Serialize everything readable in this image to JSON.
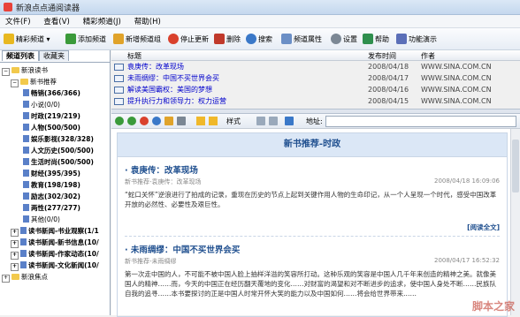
{
  "window": {
    "title": "新浪点点通阅读器"
  },
  "menu": [
    "文件(F)",
    "查看(V)",
    "精彩频道(J)",
    "帮助(H)"
  ],
  "toolbar": [
    {
      "label": "精彩频道",
      "icon": "star-icon",
      "color": "#e8b820"
    },
    {
      "label": "添加频道",
      "icon": "add-icon",
      "color": "#3a9a3a"
    },
    {
      "label": "新增频道组",
      "icon": "folder-add-icon",
      "color": "#e0a32a"
    },
    {
      "label": "停止更新",
      "icon": "stop-icon",
      "color": "#d9412d"
    },
    {
      "label": "删除",
      "icon": "delete-icon",
      "color": "#c0392b"
    },
    {
      "label": "搜索",
      "icon": "search-icon",
      "color": "#3a78c8"
    },
    {
      "label": "频道属性",
      "icon": "properties-icon",
      "color": "#6b8fc6"
    },
    {
      "label": "设置",
      "icon": "settings-icon",
      "color": "#7b8794"
    },
    {
      "label": "帮助",
      "icon": "help-icon",
      "color": "#2f8f4e"
    },
    {
      "label": "功能演示",
      "icon": "demo-icon",
      "color": "#5b6fb8"
    }
  ],
  "sidebar": {
    "tabs": [
      "频道列表",
      "收藏夹"
    ],
    "root": "新浪读书",
    "group": "新书推荐",
    "items": [
      {
        "label": "畅销(366/366)",
        "selected": false
      },
      {
        "label": "小说(0/0)",
        "selected": false
      },
      {
        "label": "时政(219/219)",
        "selected": true
      },
      {
        "label": "人物(500/500)",
        "selected": false
      },
      {
        "label": "娱乐影视(328/328)",
        "selected": false
      },
      {
        "label": "人文历史(500/500)",
        "selected": false
      },
      {
        "label": "生活时尚(500/500)",
        "selected": false
      },
      {
        "label": "财经(395/395)",
        "selected": false
      },
      {
        "label": "教育(198/198)",
        "selected": false
      },
      {
        "label": "励志(302/302)",
        "selected": false
      },
      {
        "label": "两性(277/277)",
        "selected": false
      },
      {
        "label": "其他(0/0)",
        "selected": false
      }
    ],
    "groups": [
      "读书新闻-书业观察(1/1",
      "读书新闻-新书信息(10/",
      "读书新闻-作家动态(10/",
      "读书新闻-文化新闻(10/"
    ],
    "root2": "新浪焦点"
  },
  "list": {
    "headers": [
      "标题",
      "发布时间",
      "作者"
    ],
    "rows": [
      {
        "title": "袁庚传：改革现场",
        "date": "2008/04/18",
        "author": "WWW.SINA.COM.CN"
      },
      {
        "title": "未雨绸缪：中国不买世界会买",
        "date": "2008/04/17",
        "author": "WWW.SINA.COM.CN"
      },
      {
        "title": "解读美国霸权：美国的梦想",
        "date": "2008/04/16",
        "author": "WWW.SINA.COM.CN"
      },
      {
        "title": "提升执行力和领导力：权力运营",
        "date": "2008/04/15",
        "author": "WWW.SINA.COM.CN"
      }
    ]
  },
  "browser": {
    "style_label": "样式",
    "address_label": "地址:"
  },
  "page": {
    "heading": "新书推荐-时政",
    "articles": [
      {
        "title": "· 袁庚传：改革现场",
        "meta": "新书推荐-袁庚传：改革现场",
        "date": "2008/04/18 16:09:06",
        "body": "“蛇口关怀”逆浪进行了拍成的记录，重现在历史的节点上起到关键作用人物的生命印记，从一个人呈现一个时代，感受中国改革开放的必然性、必要性及艰巨性。",
        "readmore": "[阅读全文]"
      },
      {
        "title": "· 未雨绸缪：中国不买世界会买",
        "meta": "新书推荐-未雨绸缪",
        "date": "2008/04/17 16:52:32",
        "body": "第一次走中国的人，不可能不被中国人脸上抽样洋溢的笑容所打动。这种乐观的笑容是中国人几千年来创造的精神之美。就像美国人的精神……而，今天的中国正在经历翻天覆地的变化……对财富的渴望和对不断进步的追求，使中国人身处不断……民族队自我的追寻……本书要探讨的正是中国人时常开怀大笑的能力以及中国如何……将会给世界带来……"
      }
    ]
  },
  "watermark": "脚本之家"
}
